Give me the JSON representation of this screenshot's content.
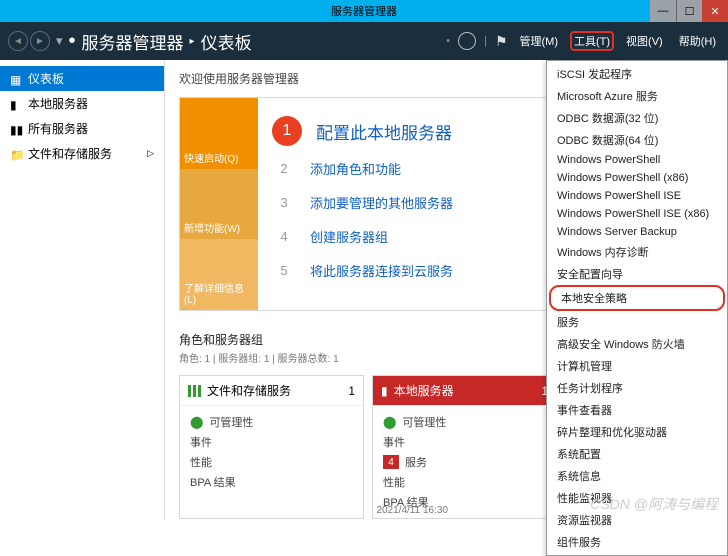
{
  "window": {
    "title": "服务器管理器"
  },
  "header": {
    "breadcrumb1": "服务器管理器",
    "breadcrumb2": "仪表板",
    "menu": {
      "manage": "管理(M)",
      "tools": "工具(T)",
      "view": "视图(V)",
      "help": "帮助(H)"
    }
  },
  "sidebar": {
    "dashboard": "仪表板",
    "local": "本地服务器",
    "all": "所有服务器",
    "storage": "文件和存储服务"
  },
  "welcome": {
    "title": "欢迎使用服务器管理器",
    "tab1": "快速启动(Q)",
    "tab2": "新增功能(W)",
    "tab3": "了解详细信息(L)",
    "step1": "配置此本地服务器",
    "step2": "添加角色和功能",
    "step3": "添加要管理的其他服务器",
    "step4": "创建服务器组",
    "step5": "将此服务器连接到云服务"
  },
  "roles": {
    "title": "角色和服务器组",
    "sub": "角色: 1 | 服务器组: 1 | 服务器总数: 1"
  },
  "tile1": {
    "title": "文件和存储服务",
    "count": "1",
    "r1": "可管理性",
    "r2": "事件",
    "r3": "性能",
    "r4": "BPA 结果"
  },
  "tile2": {
    "title": "本地服务器",
    "count": "1",
    "r1": "可管理性",
    "r2": "事件",
    "r3n": "4",
    "r3": "服务",
    "r4": "性能",
    "r5": "BPA 结果"
  },
  "timestamp": "2021/4/11 16:30",
  "tools_menu": {
    "i1": "iSCSI 发起程序",
    "i2": "Microsoft Azure 服务",
    "i3": "ODBC 数据源(32 位)",
    "i4": "ODBC 数据源(64 位)",
    "i5": "Windows PowerShell",
    "i6": "Windows PowerShell (x86)",
    "i7": "Windows PowerShell ISE",
    "i8": "Windows PowerShell ISE (x86)",
    "i9": "Windows Server Backup",
    "i10": "Windows 内存诊断",
    "i11": "安全配置向导",
    "i12": "本地安全策略",
    "i13": "服务",
    "i14": "高级安全 Windows 防火墙",
    "i15": "计算机管理",
    "i16": "任务计划程序",
    "i17": "事件查看器",
    "i18": "碎片整理和优化驱动器",
    "i19": "系统配置",
    "i20": "系统信息",
    "i21": "性能监视器",
    "i22": "资源监视器",
    "i23": "组件服务"
  },
  "watermark": "CSDN @阿涛与编程"
}
